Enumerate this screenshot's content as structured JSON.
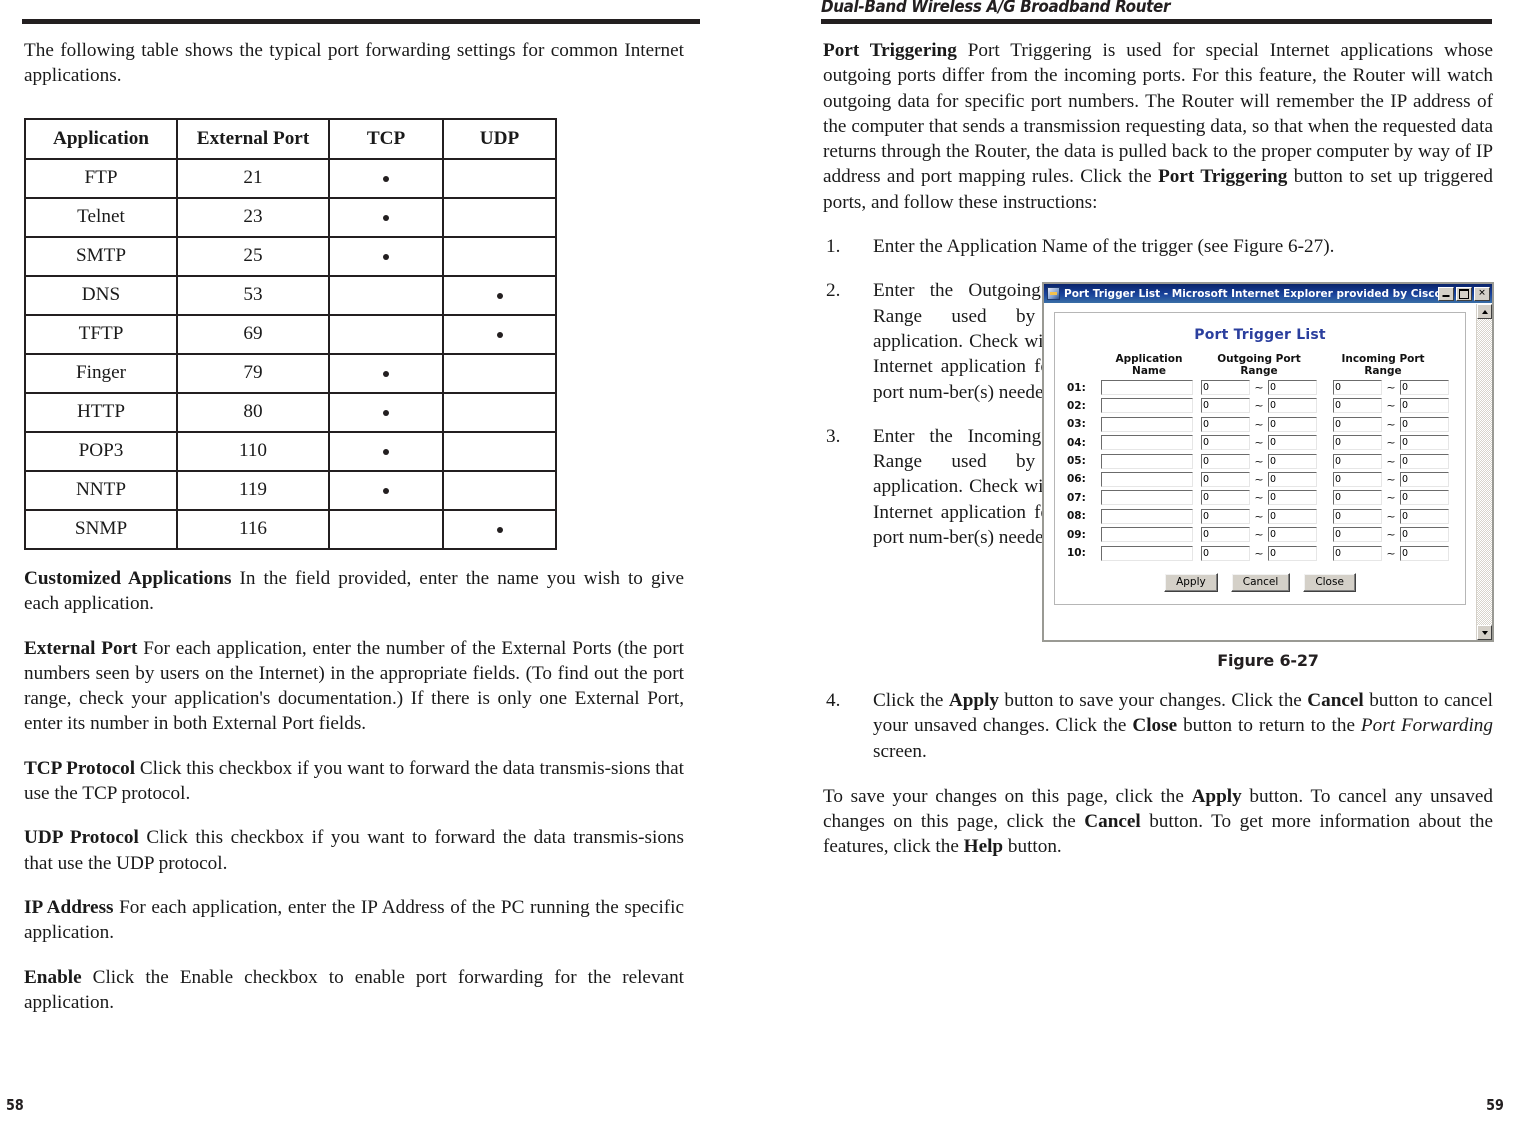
{
  "document": {
    "running_head": "Dual-Band Wireless A/G Broadband Router"
  },
  "left_page": {
    "folio": "58",
    "intro_paragraph": "The following table shows the typical port forwarding settings for common Internet applications.",
    "port_table": {
      "columns": [
        "Application",
        "External Port",
        "TCP",
        "UDP"
      ],
      "rows": [
        {
          "application": "FTP",
          "external_port": "21",
          "tcp": true,
          "udp": false
        },
        {
          "application": "Telnet",
          "external_port": "23",
          "tcp": true,
          "udp": false
        },
        {
          "application": "SMTP",
          "external_port": "25",
          "tcp": true,
          "udp": false
        },
        {
          "application": "DNS",
          "external_port": "53",
          "tcp": false,
          "udp": true
        },
        {
          "application": "TFTP",
          "external_port": "69",
          "tcp": false,
          "udp": true
        },
        {
          "application": "Finger",
          "external_port": "79",
          "tcp": true,
          "udp": false
        },
        {
          "application": "HTTP",
          "external_port": "80",
          "tcp": true,
          "udp": false
        },
        {
          "application": "POP3",
          "external_port": "110",
          "tcp": true,
          "udp": false
        },
        {
          "application": "NNTP",
          "external_port": "119",
          "tcp": true,
          "udp": false
        },
        {
          "application": "SNMP",
          "external_port": "116",
          "tcp": false,
          "udp": true
        }
      ]
    },
    "definitions": [
      {
        "term": "Customized Applications",
        "text": "In the  field provided, enter the name you wish to give each application."
      },
      {
        "term": "External Port",
        "text": "For each application, enter the number of the External Ports (the port numbers seen by users on the Internet) in the appropriate fields. (To find out the port range, check your application's documentation.) If there is only one External Port, enter its number in both External Port fields."
      },
      {
        "term": "TCP Protocol",
        "text": "Click this checkbox if you want to forward the data transmis-sions that use the TCP protocol."
      },
      {
        "term": "UDP Protocol",
        "text": "Click this checkbox if you want to forward the data transmis-sions that use the UDP protocol."
      },
      {
        "term": "IP Address",
        "text": "For each application, enter the IP Address of the PC running the specific application."
      },
      {
        "term": "Enable",
        "text": "Click the Enable checkbox to enable port forwarding for the relevant application."
      }
    ]
  },
  "right_page": {
    "folio": "59",
    "port_triggering": {
      "term": "Port Triggering",
      "body_part1": "Port Triggering is used for special Internet applications whose outgoing ports differ from the incoming ports. For this feature, the Router will watch outgoing data for specific port numbers. The Router will remember the IP address of the computer that sends a transmission requesting data, so that when the requested data returns through the Router, the data is pulled back to the proper computer by way of IP address and port mapping rules. Click the ",
      "bold_inline": "Port Triggering",
      "body_part2": " button to set up triggered ports, and follow these instructions:"
    },
    "steps": [
      {
        "num": "1.",
        "text": "Enter the Application Name of the trigger (see Figure 6-27)."
      },
      {
        "num": "2.",
        "text": "Enter the Outgoing Port Range used by the application. Check with the Internet application for the port num-ber(s) needed."
      },
      {
        "num": "3.",
        "text": "Enter the Incoming Port Range used by the application. Check with the Internet application for the port num-ber(s) needed."
      }
    ],
    "step4": {
      "num": "4.",
      "t1": "Click the ",
      "b1": "Apply",
      "t2": " button to save your changes. Click the ",
      "b2": "Cancel",
      "t3": " button to cancel your unsaved changes. Click the ",
      "b3": "Close",
      "t4": " button to return to the ",
      "i1": "Port Forwarding",
      "t5": " screen."
    },
    "closing": {
      "t1": "To save your changes on this page, click the ",
      "b1": "Apply",
      "t2": " button. To cancel any unsaved changes on this page, click the ",
      "b2": "Cancel",
      "t3": " button. To get more information about the features, click the ",
      "b3": "Help",
      "t4": " button."
    },
    "figure": {
      "caption": "Figure 6-27",
      "window_title": "Port Trigger List - Microsoft Internet Explorer provided by Cisco Systems, Inc.",
      "panel_title": "Port Trigger List",
      "column_headers": {
        "application_name": "Application Name",
        "outgoing_port_range": "Outgoing Port Range",
        "incoming_port_range": "Incoming Port Range"
      },
      "tilde": "~",
      "rows": [
        {
          "index": "01:",
          "app_name": "",
          "out_from": "0",
          "out_to": "0",
          "in_from": "0",
          "in_to": "0"
        },
        {
          "index": "02:",
          "app_name": "",
          "out_from": "0",
          "out_to": "0",
          "in_from": "0",
          "in_to": "0"
        },
        {
          "index": "03:",
          "app_name": "",
          "out_from": "0",
          "out_to": "0",
          "in_from": "0",
          "in_to": "0"
        },
        {
          "index": "04:",
          "app_name": "",
          "out_from": "0",
          "out_to": "0",
          "in_from": "0",
          "in_to": "0"
        },
        {
          "index": "05:",
          "app_name": "",
          "out_from": "0",
          "out_to": "0",
          "in_from": "0",
          "in_to": "0"
        },
        {
          "index": "06:",
          "app_name": "",
          "out_from": "0",
          "out_to": "0",
          "in_from": "0",
          "in_to": "0"
        },
        {
          "index": "07:",
          "app_name": "",
          "out_from": "0",
          "out_to": "0",
          "in_from": "0",
          "in_to": "0"
        },
        {
          "index": "08:",
          "app_name": "",
          "out_from": "0",
          "out_to": "0",
          "in_from": "0",
          "in_to": "0"
        },
        {
          "index": "09:",
          "app_name": "",
          "out_from": "0",
          "out_to": "0",
          "in_from": "0",
          "in_to": "0"
        },
        {
          "index": "10:",
          "app_name": "",
          "out_from": "0",
          "out_to": "0",
          "in_from": "0",
          "in_to": "0"
        }
      ],
      "buttons": {
        "apply": "Apply",
        "cancel": "Cancel",
        "close": "Close"
      },
      "titlebar_buttons": {
        "minimize": "minimize",
        "maximize": "maximize",
        "close": "close"
      },
      "colors": {
        "titlebar": "#0a246a",
        "panel_title": "#2b3f9e",
        "window_face": "#d4d0c8"
      }
    }
  }
}
